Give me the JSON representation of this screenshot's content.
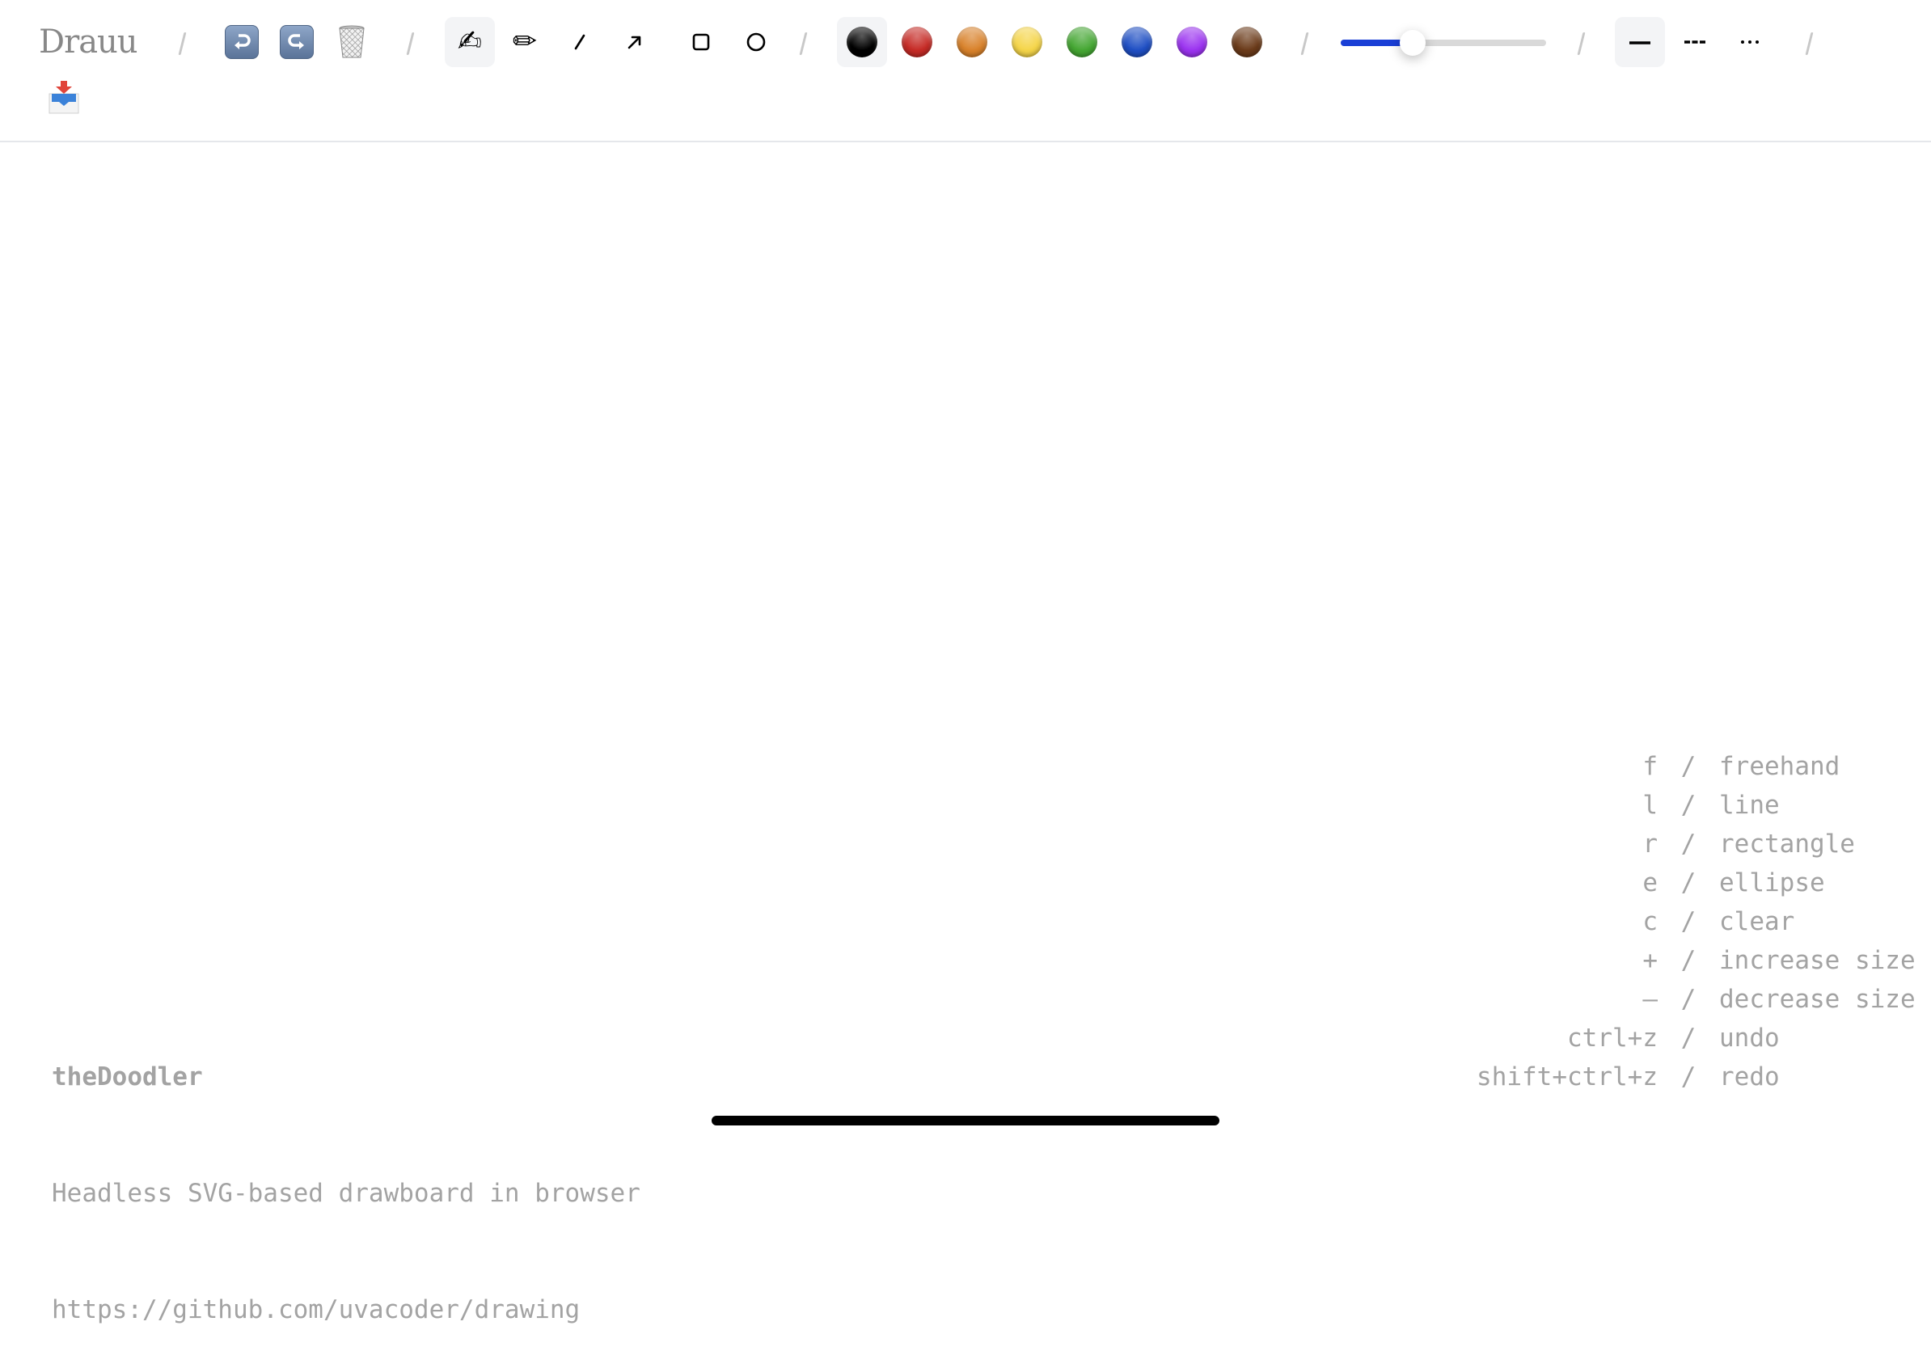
{
  "app": {
    "title": "Drauu"
  },
  "toolbar": {
    "separator": "/",
    "history": [
      {
        "id": "undo",
        "icon": "undo-icon",
        "glyph": "↩"
      },
      {
        "id": "redo",
        "icon": "redo-icon",
        "glyph": "↪"
      },
      {
        "id": "clear",
        "icon": "wastebasket-icon",
        "glyph": "🗑"
      }
    ],
    "tools": [
      {
        "id": "stylus",
        "icon": "writing-hand-icon",
        "glyph": "✍",
        "active": true
      },
      {
        "id": "draw",
        "icon": "pencil-icon",
        "glyph": "✏",
        "active": false
      },
      {
        "id": "line",
        "icon": "line-icon",
        "glyph": "∕",
        "active": false
      },
      {
        "id": "arrow",
        "icon": "arrow-icon",
        "glyph": "↗",
        "active": false
      },
      {
        "id": "rectangle",
        "icon": "rectangle-icon",
        "glyph": "□",
        "active": false
      },
      {
        "id": "ellipse",
        "icon": "ellipse-icon",
        "glyph": "○",
        "active": false
      }
    ],
    "colors": [
      {
        "name": "black",
        "hex": "#000000",
        "active": true
      },
      {
        "name": "red",
        "hex": "#c62b26",
        "active": false
      },
      {
        "name": "orange",
        "hex": "#d9822b",
        "active": false
      },
      {
        "name": "yellow",
        "hex": "#f5d549",
        "active": false
      },
      {
        "name": "green",
        "hex": "#45a733",
        "active": false
      },
      {
        "name": "blue",
        "hex": "#1f4fc4",
        "active": false
      },
      {
        "name": "purple",
        "hex": "#9b33f0",
        "active": false
      },
      {
        "name": "brown",
        "hex": "#6b3b1a",
        "active": false
      }
    ],
    "size_slider": {
      "value_fraction": 0.35,
      "accent": "#1a3fd6"
    },
    "dash_styles": [
      {
        "id": "solid",
        "icon": "solid-line-icon",
        "active": true
      },
      {
        "id": "dashed",
        "icon": "dashed-line-icon",
        "active": false
      },
      {
        "id": "dotted",
        "icon": "dotted-line-icon",
        "active": false
      }
    ],
    "download": {
      "icon": "inbox-tray-icon",
      "glyph": "📥"
    }
  },
  "info": {
    "title": "theDoodler",
    "description": "Headless SVG-based drawboard in browser",
    "url": "https://github.com/uvacoder/drawing"
  },
  "shortcuts": [
    {
      "key": "f",
      "action": "freehand"
    },
    {
      "key": "l",
      "action": "line"
    },
    {
      "key": "r",
      "action": "rectangle"
    },
    {
      "key": "e",
      "action": "ellipse"
    },
    {
      "key": "c",
      "action": "clear"
    },
    {
      "key": "+",
      "action": "increase size"
    },
    {
      "key": "–",
      "action": "decrease size"
    },
    {
      "key": "ctrl+z",
      "action": "undo"
    },
    {
      "key": "shift+ctrl+z",
      "action": "redo"
    }
  ],
  "shortcut_separator": "/"
}
